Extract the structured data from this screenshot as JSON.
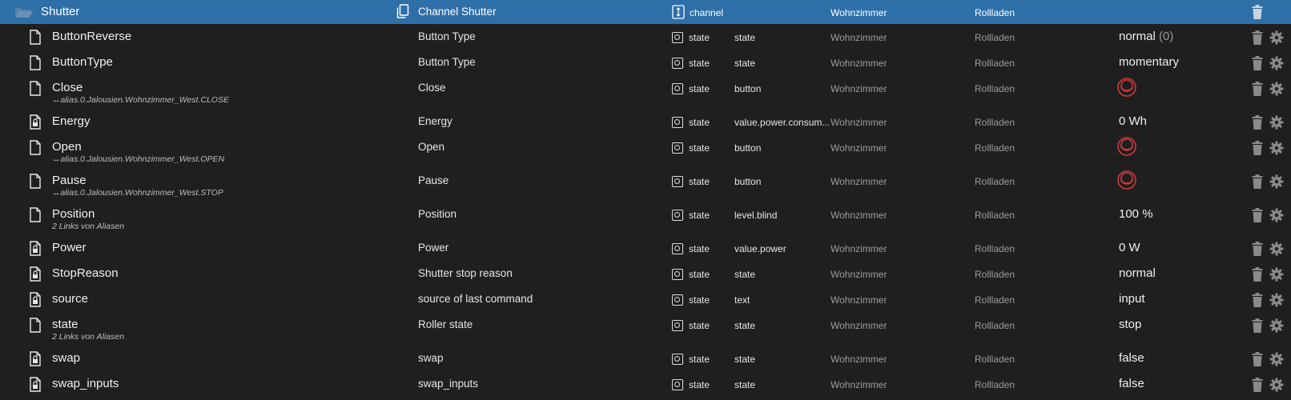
{
  "header": {
    "name": "Shutter",
    "description": "Channel Shutter",
    "type": "channel",
    "room": "Wohnzimmer",
    "function": "Rollladen",
    "folder_icon": "folder-open-icon",
    "copy_icon": "copy-icon",
    "channel_icon": "channel-icon",
    "delete_icon": "trash-icon"
  },
  "rows": [
    {
      "name": "ButtonReverse",
      "alias": "",
      "desc": "Button Type",
      "type": "state",
      "role": "state",
      "room": "Wohnzimmer",
      "function": "Rollladen",
      "value": "normal",
      "value_suffix": "(0)",
      "value_kind": "text",
      "icon": "file-icon"
    },
    {
      "name": "ButtonType",
      "alias": "",
      "desc": "Button Type",
      "type": "state",
      "role": "state",
      "room": "Wohnzimmer",
      "function": "Rollladen",
      "value": "momentary",
      "value_suffix": "",
      "value_kind": "text",
      "icon": "file-icon"
    },
    {
      "name": "Close",
      "alias": "↔alias.0.Jalousien.Wohnzimmer_West.CLOSE",
      "desc": "Close",
      "type": "state",
      "role": "button",
      "room": "Wohnzimmer",
      "function": "Rollladen",
      "value": "",
      "value_suffix": "",
      "value_kind": "button",
      "icon": "file-icon"
    },
    {
      "name": "Energy",
      "alias": "",
      "desc": "Energy",
      "type": "state",
      "role": "value.power.consum...",
      "room": "Wohnzimmer",
      "function": "Rollladen",
      "value": "0 Wh",
      "value_suffix": "",
      "value_kind": "text",
      "icon": "file-lock-icon"
    },
    {
      "name": "Open",
      "alias": "↔alias.0.Jalousien.Wohnzimmer_West.OPEN",
      "desc": "Open",
      "type": "state",
      "role": "button",
      "room": "Wohnzimmer",
      "function": "Rollladen",
      "value": "",
      "value_suffix": "",
      "value_kind": "button",
      "icon": "file-icon"
    },
    {
      "name": "Pause",
      "alias": "↔alias.0.Jalousien.Wohnzimmer_West.STOP",
      "desc": "Pause",
      "type": "state",
      "role": "button",
      "room": "Wohnzimmer",
      "function": "Rollladen",
      "value": "",
      "value_suffix": "",
      "value_kind": "button",
      "icon": "file-icon"
    },
    {
      "name": "Position",
      "alias": "2 Links von Aliasen",
      "desc": "Position",
      "type": "state",
      "role": "level.blind",
      "room": "Wohnzimmer",
      "function": "Rollladen",
      "value": "100 %",
      "value_suffix": "",
      "value_kind": "text",
      "icon": "file-icon"
    },
    {
      "name": "Power",
      "alias": "",
      "desc": "Power",
      "type": "state",
      "role": "value.power",
      "room": "Wohnzimmer",
      "function": "Rollladen",
      "value": "0 W",
      "value_suffix": "",
      "value_kind": "text",
      "icon": "file-lock-icon"
    },
    {
      "name": "StopReason",
      "alias": "",
      "desc": "Shutter stop reason",
      "type": "state",
      "role": "state",
      "room": "Wohnzimmer",
      "function": "Rollladen",
      "value": "normal",
      "value_suffix": "",
      "value_kind": "text",
      "icon": "file-lock-icon"
    },
    {
      "name": "source",
      "alias": "",
      "desc": "source of last command",
      "type": "state",
      "role": "text",
      "room": "Wohnzimmer",
      "function": "Rollladen",
      "value": "input",
      "value_suffix": "",
      "value_kind": "text",
      "icon": "file-lock-icon"
    },
    {
      "name": "state",
      "alias": "2 Links von Aliasen",
      "desc": "Roller state",
      "type": "state",
      "role": "state",
      "room": "Wohnzimmer",
      "function": "Rollladen",
      "value": "stop",
      "value_suffix": "",
      "value_kind": "text",
      "icon": "file-icon"
    },
    {
      "name": "swap",
      "alias": "",
      "desc": "swap",
      "type": "state",
      "role": "state",
      "room": "Wohnzimmer",
      "function": "Rollladen",
      "value": "false",
      "value_suffix": "",
      "value_kind": "text",
      "icon": "file-lock-icon"
    },
    {
      "name": "swap_inputs",
      "alias": "",
      "desc": "swap_inputs",
      "type": "state",
      "role": "state",
      "room": "Wohnzimmer",
      "function": "Rollladen",
      "value": "false",
      "value_suffix": "",
      "value_kind": "text",
      "icon": "file-lock-icon"
    }
  ],
  "colors": {
    "header_bg": "#2f6fa8",
    "background": "#1f1f1f",
    "button_red": "#d23b3b",
    "muted": "#9c9c9c"
  }
}
